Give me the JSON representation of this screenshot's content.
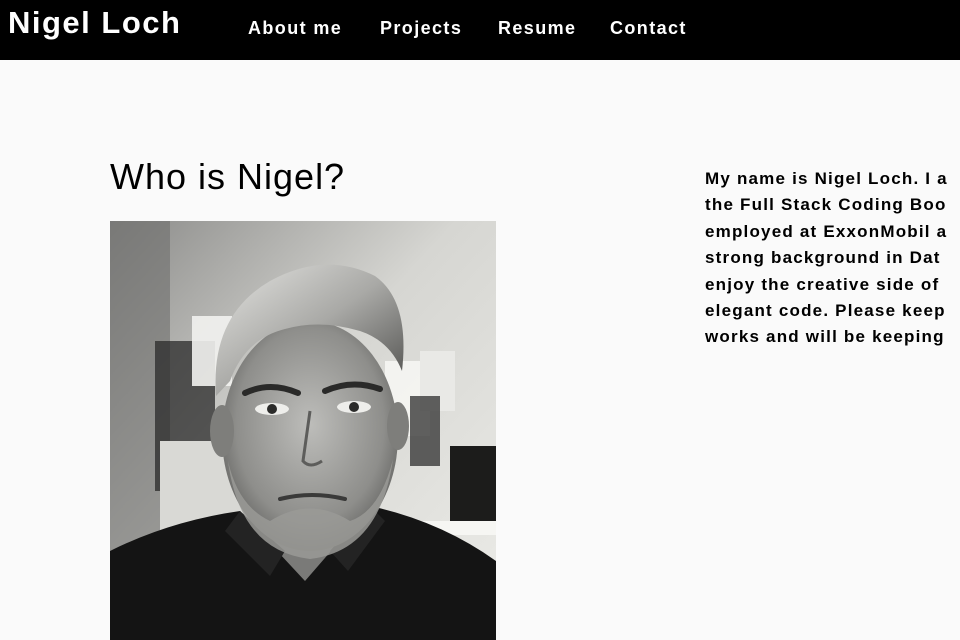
{
  "header": {
    "brand": "Nigel Loch",
    "nav": [
      "About me",
      "Projects",
      "Resume",
      "Contact"
    ]
  },
  "main": {
    "heading": "Who is Nigel?",
    "bio_lines": [
      "My name is Nigel Loch. I a",
      "the Full Stack Coding Boo",
      "employed at ExxonMobil a",
      "strong background in Dat",
      "enjoy the creative side of",
      "elegant code. Please keep",
      "works and will be keeping"
    ]
  },
  "colors": {
    "header_bg": "#000000",
    "page_bg": "#fafafa",
    "text": "#000000"
  }
}
